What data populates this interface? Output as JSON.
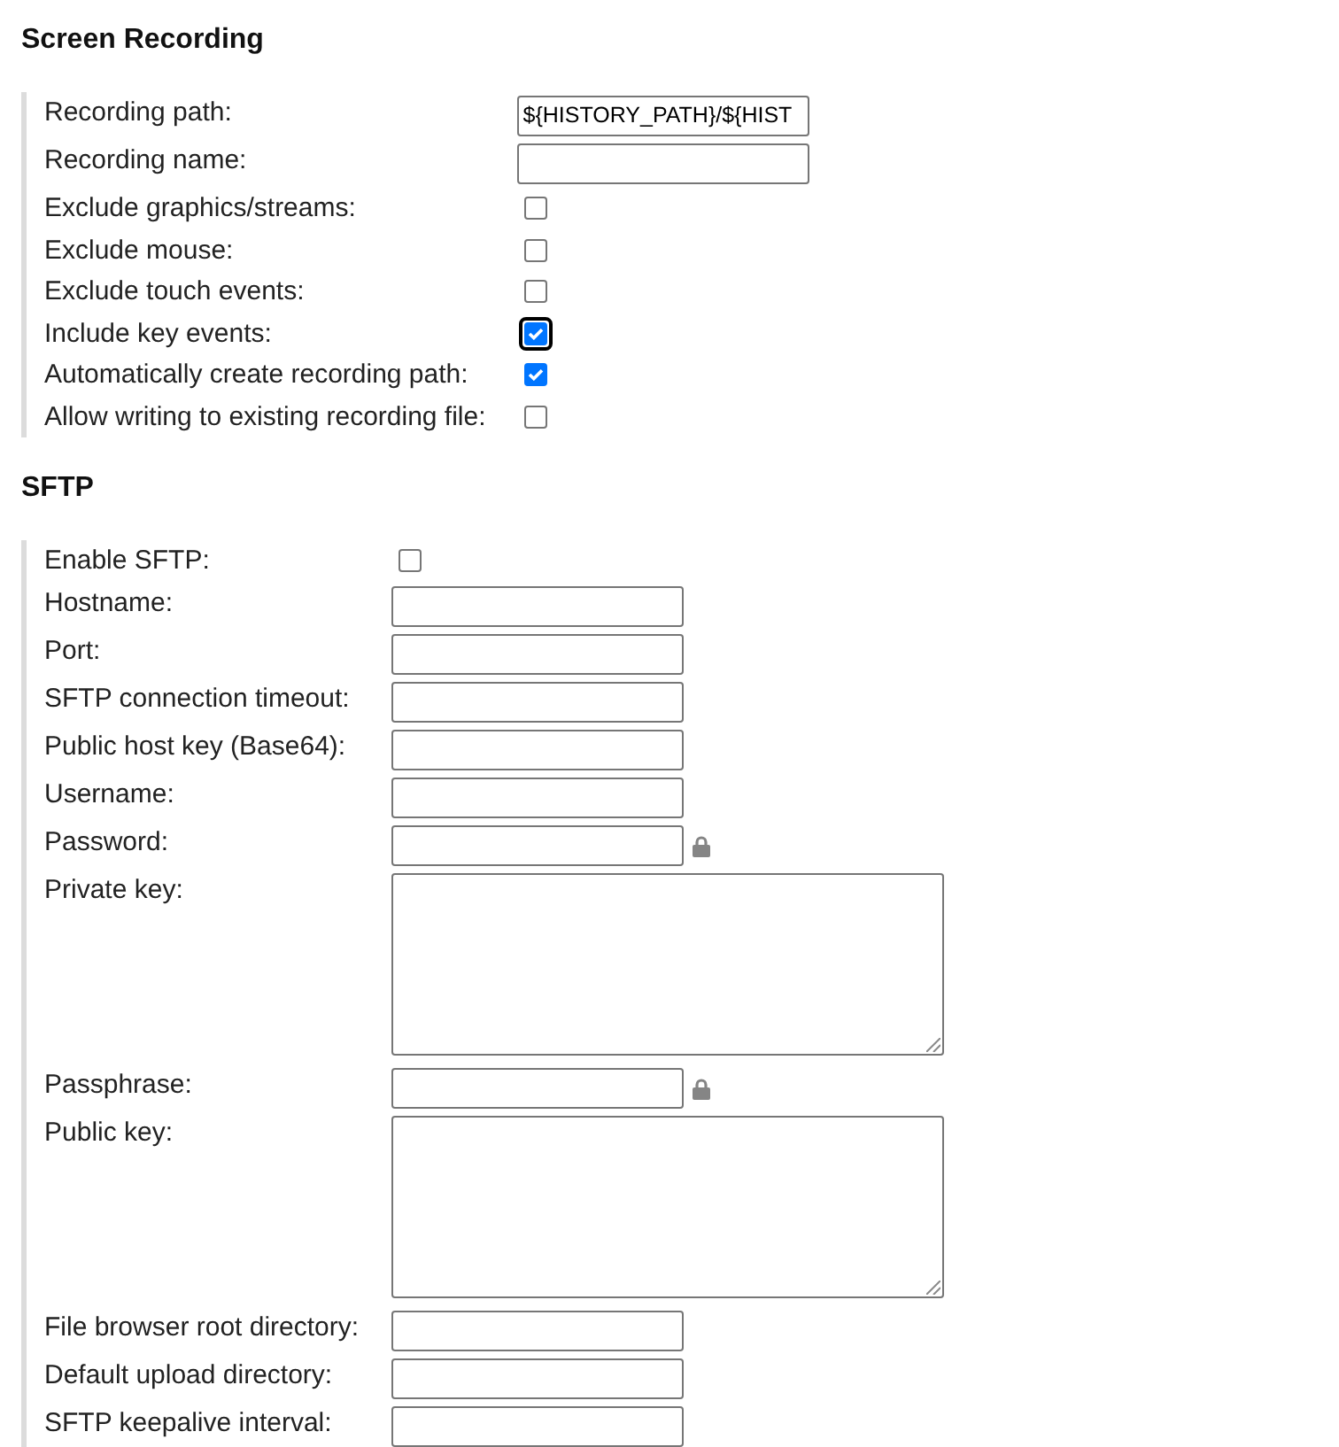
{
  "sections": [
    {
      "title": "Screen Recording",
      "fields": [
        {
          "kind": "text",
          "label": "Recording path:",
          "value": "${HISTORY_PATH}/${HIST"
        },
        {
          "kind": "text",
          "label": "Recording name:"
        },
        {
          "kind": "checkbox",
          "label": "Exclude graphics/streams:",
          "checked": false,
          "focused": false
        },
        {
          "kind": "checkbox",
          "label": "Exclude mouse:",
          "checked": false,
          "focused": false
        },
        {
          "kind": "checkbox",
          "label": "Exclude touch events:",
          "checked": false,
          "focused": false
        },
        {
          "kind": "checkbox",
          "label": "Include key events:",
          "checked": true,
          "focused": true
        },
        {
          "kind": "checkbox",
          "label": "Automatically create recording path:",
          "checked": true,
          "focused": false
        },
        {
          "kind": "checkbox",
          "label": "Allow writing to existing recording file:",
          "checked": false,
          "focused": false
        }
      ]
    },
    {
      "title": "SFTP",
      "fields": [
        {
          "kind": "checkbox",
          "label": "Enable SFTP:",
          "checked": false,
          "focused": false
        },
        {
          "kind": "text",
          "label": "Hostname:"
        },
        {
          "kind": "text",
          "label": "Port:"
        },
        {
          "kind": "text",
          "label": "SFTP connection timeout:"
        },
        {
          "kind": "text",
          "label": "Public host key (Base64):"
        },
        {
          "kind": "text",
          "label": "Username:"
        },
        {
          "kind": "password",
          "label": "Password:"
        },
        {
          "kind": "textarea",
          "label": "Private key:"
        },
        {
          "kind": "password",
          "label": "Passphrase:"
        },
        {
          "kind": "textarea",
          "label": "Public key:"
        },
        {
          "kind": "text",
          "label": "File browser root directory:"
        },
        {
          "kind": "text",
          "label": "Default upload directory:"
        },
        {
          "kind": "text",
          "label": "SFTP keepalive interval:"
        }
      ]
    }
  ]
}
